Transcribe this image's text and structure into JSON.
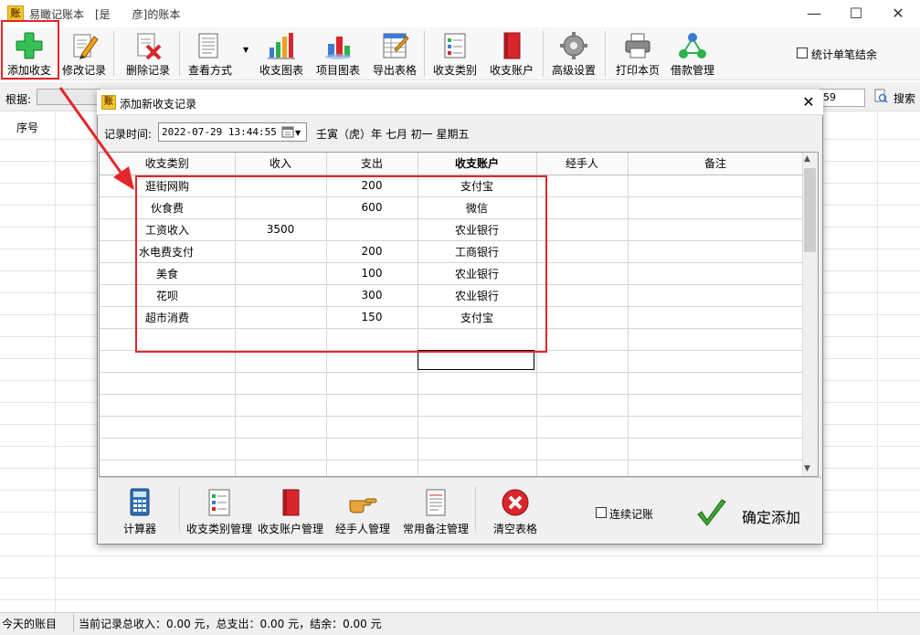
{
  "window": {
    "title": "易瞰记账本　[是　　彦]的账本",
    "icon_text": "账",
    "controls": [
      "minimize-icon",
      "maximize-icon",
      "close-icon"
    ]
  },
  "toolbar": {
    "buttons": [
      {
        "label": "添加收支",
        "icon": "add-plus-icon"
      },
      {
        "label": "修改记录",
        "icon": "edit-pencil-icon"
      },
      {
        "label": "删除记录",
        "icon": "delete-doc-icon"
      },
      {
        "label": "查看方式",
        "icon": "view-doc-icon"
      },
      {
        "label": "收支图表",
        "icon": "bar-chart-icon"
      },
      {
        "label": "项目图表",
        "icon": "project-chart-icon"
      },
      {
        "label": "导出表格",
        "icon": "export-table-icon"
      },
      {
        "label": "收支类别",
        "icon": "category-list-icon"
      },
      {
        "label": "收支账户",
        "icon": "account-book-icon"
      },
      {
        "label": "高级设置",
        "icon": "gear-icon"
      },
      {
        "label": "打印本页",
        "icon": "printer-icon"
      },
      {
        "label": "借款管理",
        "icon": "loan-network-icon"
      }
    ],
    "stat_checkbox_label": "统计单笔结余"
  },
  "filter_bar": {
    "basis_label": "根据:",
    "date_tail": "59",
    "search_label": "搜索"
  },
  "main_grid": {
    "seq_header": "序号"
  },
  "status": {
    "left": "今天的账目",
    "right": "当前记录总收入：0.00 元，总支出：0.00 元，结余：0.00 元"
  },
  "dialog": {
    "title": "添加新收支记录",
    "icon_text": "账",
    "record_time_label": "记录时间:",
    "record_time_value": "2022-07-29 13:44:55",
    "lunar_text": "壬寅（虎）年 七月 初一 星期五",
    "columns": [
      "收支类别",
      "收入",
      "支出",
      "收支账户",
      "经手人",
      "备注"
    ],
    "rows": [
      {
        "category": "逛街网购",
        "income": "",
        "expense": "200",
        "account": "支付宝",
        "handler": "",
        "note": ""
      },
      {
        "category": "伙食费",
        "income": "",
        "expense": "600",
        "account": "微信",
        "handler": "",
        "note": ""
      },
      {
        "category": "工资收入",
        "income": "3500",
        "expense": "",
        "account": "农业银行",
        "handler": "",
        "note": ""
      },
      {
        "category": "水电费支付",
        "income": "",
        "expense": "200",
        "account": "工商银行",
        "handler": "",
        "note": ""
      },
      {
        "category": "美食",
        "income": "",
        "expense": "100",
        "account": "农业银行",
        "handler": "",
        "note": ""
      },
      {
        "category": "花呗",
        "income": "",
        "expense": "300",
        "account": "农业银行",
        "handler": "",
        "note": ""
      },
      {
        "category": "超市消费",
        "income": "",
        "expense": "150",
        "account": "支付宝",
        "handler": "",
        "note": ""
      }
    ],
    "footer_buttons": [
      {
        "label": "计算器",
        "icon": "calculator-icon"
      },
      {
        "label": "收支类别管理",
        "icon": "category-manage-icon"
      },
      {
        "label": "收支账户管理",
        "icon": "account-manage-icon"
      },
      {
        "label": "经手人管理",
        "icon": "hand-pointer-icon"
      },
      {
        "label": "常用备注管理",
        "icon": "note-manage-icon"
      },
      {
        "label": "清空表格",
        "icon": "clear-x-icon"
      }
    ],
    "continuous_label": "连续记账",
    "confirm_label": "确定添加"
  },
  "colors": {
    "annotation_red": "#e3262a",
    "add_green": "#2bb24c",
    "confirm_green": "#3aa62f",
    "clear_red": "#d9262c"
  }
}
